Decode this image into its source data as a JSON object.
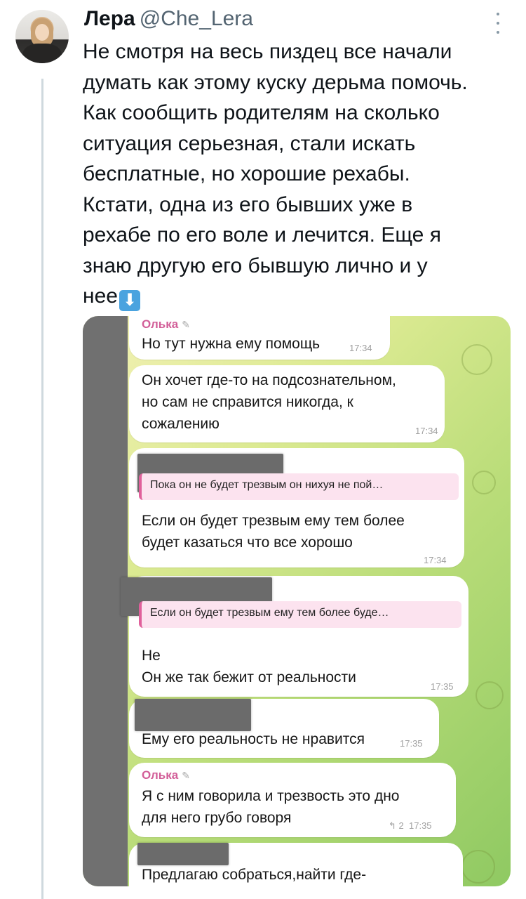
{
  "tweet": {
    "author_name": "Лера",
    "author_handle": "@Che_Lera",
    "text_lines": [
      "Не смотря на весь пиздец все начали",
      "думать как этому куску дерьма помочь.",
      "Как сообщить родителям на сколько",
      "ситуация серьезная, стали искать",
      "бесплатные, но хорошие рехабы.",
      "Кстати, одна из его бывших уже в",
      "рехабе по его воле и лечится. Еще я",
      "знаю другую его бывшую лично и у",
      "нее"
    ],
    "emoji": "⬇"
  },
  "chat": {
    "messages": [
      {
        "sender": "Олька",
        "text": [
          "Но тут нужна ему помощь"
        ],
        "time": "17:34"
      },
      {
        "text": [
          "Он хочет где-то на подсознательном,",
          "но сам не справится никогда, к",
          "сожалению"
        ],
        "time": "17:34"
      },
      {
        "quote": "Пока он не будет трезвым он нихуя не пой…",
        "text": [
          "Если он будет трезвым ему тем более",
          "будет казаться что все хорошо"
        ],
        "time": "17:34"
      },
      {
        "quote": "Если он будет трезвым ему тем более буде…",
        "text": [
          "Не",
          "Он же так бежит от реальности"
        ],
        "time": "17:35"
      },
      {
        "text": [
          "Ему его реальность не нравится"
        ],
        "time": "17:35"
      },
      {
        "sender": "Олька",
        "text": [
          "Я с ним говорила и трезвость это дно",
          "для него грубо говоря"
        ],
        "time": "17:35",
        "replies": "2"
      },
      {
        "text": [
          "Предлагаю собраться,найти где-"
        ]
      }
    ]
  }
}
